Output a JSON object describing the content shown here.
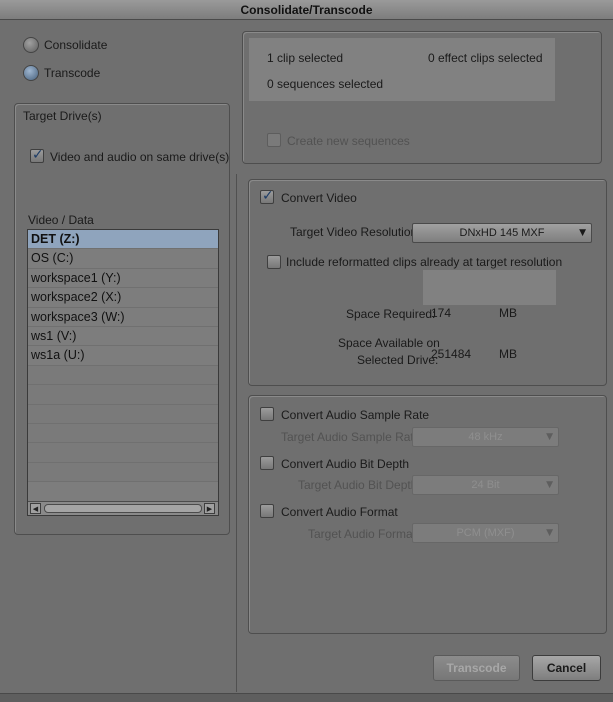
{
  "window": {
    "title": "Consolidate/Transcode"
  },
  "mode": {
    "consolidate_label": "Consolidate",
    "transcode_label": "Transcode",
    "selected": "Transcode"
  },
  "target_drives": {
    "title": "Target Drive(s)",
    "same_drive_label": "Video and audio on same drive(s)",
    "same_drive_checked": true,
    "list_label": "Video / Data",
    "drives": [
      "DET (Z:)",
      "OS (C:)",
      "workspace1 (Y:)",
      "workspace2 (X:)",
      "workspace3 (W:)",
      "ws1 (V:)",
      "ws1a (U:)"
    ],
    "selected_drive": "DET (Z:)"
  },
  "selection_info": {
    "clips": "1 clip selected",
    "effect_clips": "0 effect clips selected",
    "sequences": "0 sequences selected",
    "create_sequences_label": "Create new sequences",
    "create_sequences_checked": false
  },
  "video": {
    "convert_label": "Convert Video",
    "convert_checked": true,
    "resolution_label": "Target Video Resolution:",
    "resolution_value": "DNxHD 145  MXF",
    "include_label": "Include reformatted clips already at target resolution",
    "include_checked": false,
    "space_required_label": "Space Required:",
    "space_required_value": "174",
    "space_required_unit": "MB",
    "space_available_label_1": "Space Available on",
    "space_available_label_2": "Selected Drive:",
    "space_available_value": "251484",
    "space_available_unit": "MB"
  },
  "audio": {
    "sample_rate_label": "Convert Audio Sample Rate",
    "sample_rate_target_label": "Target Audio Sample Rate:",
    "sample_rate_value": "48 kHz",
    "bit_depth_label": "Convert Audio Bit Depth",
    "bit_depth_target_label": "Target Audio Bit Depth:",
    "bit_depth_value": "24 Bit",
    "format_label": "Convert Audio Format",
    "format_target_label": "Target Audio Format:",
    "format_value": "PCM (MXF)"
  },
  "buttons": {
    "transcode": "Transcode",
    "cancel": "Cancel"
  },
  "colors": {
    "background": "#6f6f6f",
    "selection": "#8fa4bd",
    "accent_check": "#1d3c66"
  }
}
